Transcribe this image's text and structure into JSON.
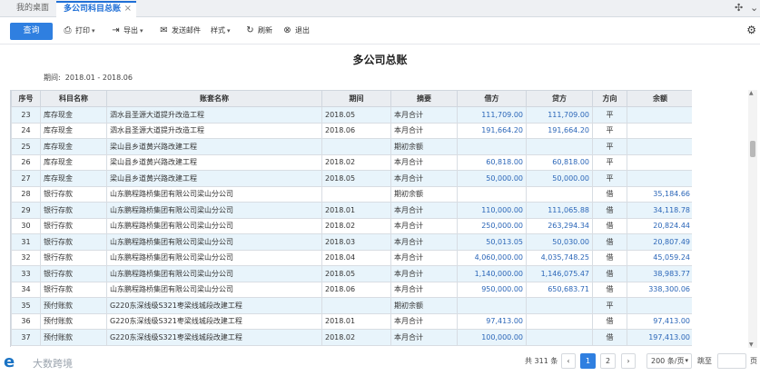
{
  "tabs": [
    {
      "label": "我的桌面"
    },
    {
      "label": "多公司科目总账"
    }
  ],
  "tab_close": "×",
  "toolbar": {
    "query": "查询",
    "print": "打印",
    "export": "导出",
    "send_email": "发送邮件",
    "style": "样式",
    "refresh": "刷新",
    "exit": "退出"
  },
  "report": {
    "title": "多公司总账",
    "period_label": "期间:",
    "period_value": "2018.01 - 2018.06"
  },
  "columns": [
    "序号",
    "科目名称",
    "账套名称",
    "期间",
    "摘要",
    "借方",
    "贷方",
    "方向",
    "余额"
  ],
  "rows": [
    [
      "23",
      "库存现金",
      "泗水县圣源大道提升改造工程",
      "2018.05",
      "本月合计",
      "111,709.00",
      "111,709.00",
      "平",
      ""
    ],
    [
      "24",
      "库存现金",
      "泗水县圣源大道提升改造工程",
      "2018.06",
      "本月合计",
      "191,664.20",
      "191,664.20",
      "平",
      ""
    ],
    [
      "25",
      "库存现金",
      "梁山县乡道黄兴路改建工程",
      "",
      "期初余额",
      "",
      "",
      "平",
      ""
    ],
    [
      "26",
      "库存现金",
      "梁山县乡道黄兴路改建工程",
      "2018.02",
      "本月合计",
      "60,818.00",
      "60,818.00",
      "平",
      ""
    ],
    [
      "27",
      "库存现金",
      "梁山县乡道黄兴路改建工程",
      "2018.05",
      "本月合计",
      "50,000.00",
      "50,000.00",
      "平",
      ""
    ],
    [
      "28",
      "银行存款",
      "山东鹏程路桥集团有限公司梁山分公司",
      "",
      "期初余额",
      "",
      "",
      "借",
      "35,184.66"
    ],
    [
      "29",
      "银行存款",
      "山东鹏程路桥集团有限公司梁山分公司",
      "2018.01",
      "本月合计",
      "110,000.00",
      "111,065.88",
      "借",
      "34,118.78"
    ],
    [
      "30",
      "银行存款",
      "山东鹏程路桥集团有限公司梁山分公司",
      "2018.02",
      "本月合计",
      "250,000.00",
      "263,294.34",
      "借",
      "20,824.44"
    ],
    [
      "31",
      "银行存款",
      "山东鹏程路桥集团有限公司梁山分公司",
      "2018.03",
      "本月合计",
      "50,013.05",
      "50,030.00",
      "借",
      "20,807.49"
    ],
    [
      "32",
      "银行存款",
      "山东鹏程路桥集团有限公司梁山分公司",
      "2018.04",
      "本月合计",
      "4,060,000.00",
      "4,035,748.25",
      "借",
      "45,059.24"
    ],
    [
      "33",
      "银行存款",
      "山东鹏程路桥集团有限公司梁山分公司",
      "2018.05",
      "本月合计",
      "1,140,000.00",
      "1,146,075.47",
      "借",
      "38,983.77"
    ],
    [
      "34",
      "银行存款",
      "山东鹏程路桥集团有限公司梁山分公司",
      "2018.06",
      "本月合计",
      "950,000.00",
      "650,683.71",
      "借",
      "338,300.06"
    ],
    [
      "35",
      "预付账款",
      "G220东深线级S321枣梁线城段改建工程",
      "",
      "期初余额",
      "",
      "",
      "平",
      ""
    ],
    [
      "36",
      "预付账款",
      "G220东深线级S321枣梁线城段改建工程",
      "2018.01",
      "本月合计",
      "97,413.00",
      "",
      "借",
      "97,413.00"
    ],
    [
      "37",
      "预付账款",
      "G220东深线级S321枣梁线城段改建工程",
      "2018.02",
      "本月合计",
      "100,000.00",
      "",
      "借",
      "197,413.00"
    ]
  ],
  "pagination": {
    "total": "共 311 条",
    "pages": [
      "1",
      "2"
    ],
    "prev": "‹",
    "next": "›",
    "page_size": "200 条/页",
    "jump_label": "跳至",
    "page_unit": "页"
  },
  "watermark": "大数跨境"
}
